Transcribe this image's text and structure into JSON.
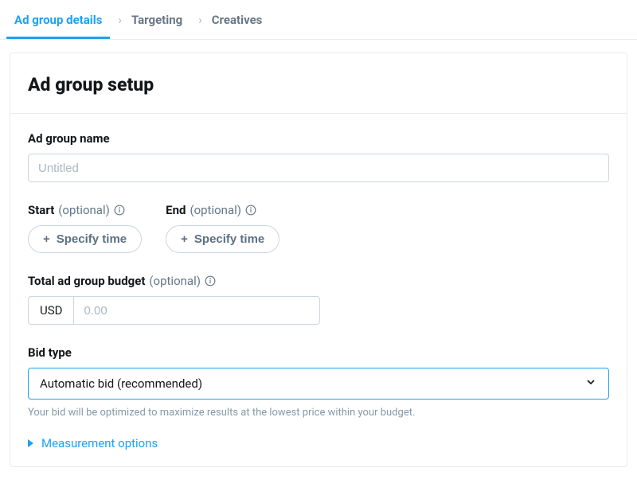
{
  "tabs": {
    "ad_group_details": "Ad group details",
    "targeting": "Targeting",
    "creatives": "Creatives"
  },
  "panel": {
    "title": "Ad group setup"
  },
  "ad_group_name": {
    "label": "Ad group name",
    "placeholder": "Untitled",
    "value": ""
  },
  "start": {
    "label": "Start",
    "optional": "(optional)",
    "button": "Specify time"
  },
  "end": {
    "label": "End",
    "optional": "(optional)",
    "button": "Specify time"
  },
  "budget": {
    "label": "Total ad group budget",
    "optional": "(optional)",
    "currency": "USD",
    "placeholder": "0.00",
    "value": ""
  },
  "bid_type": {
    "label": "Bid type",
    "selected": "Automatic bid (recommended)",
    "helper": "Your bid will be optimized to maximize results at the lowest price within your budget."
  },
  "measurement": {
    "label": "Measurement options"
  }
}
